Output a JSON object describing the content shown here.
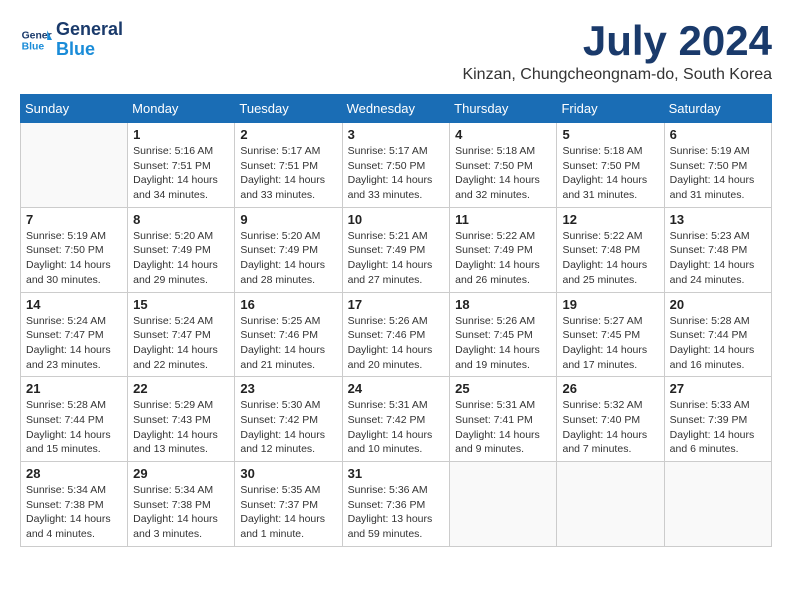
{
  "logo": {
    "line1": "General",
    "line2": "Blue"
  },
  "title": "July 2024",
  "location": "Kinzan, Chungcheongnam-do, South Korea",
  "days_of_week": [
    "Sunday",
    "Monday",
    "Tuesday",
    "Wednesday",
    "Thursday",
    "Friday",
    "Saturday"
  ],
  "weeks": [
    [
      {
        "day": "",
        "info": ""
      },
      {
        "day": "1",
        "info": "Sunrise: 5:16 AM\nSunset: 7:51 PM\nDaylight: 14 hours\nand 34 minutes."
      },
      {
        "day": "2",
        "info": "Sunrise: 5:17 AM\nSunset: 7:51 PM\nDaylight: 14 hours\nand 33 minutes."
      },
      {
        "day": "3",
        "info": "Sunrise: 5:17 AM\nSunset: 7:50 PM\nDaylight: 14 hours\nand 33 minutes."
      },
      {
        "day": "4",
        "info": "Sunrise: 5:18 AM\nSunset: 7:50 PM\nDaylight: 14 hours\nand 32 minutes."
      },
      {
        "day": "5",
        "info": "Sunrise: 5:18 AM\nSunset: 7:50 PM\nDaylight: 14 hours\nand 31 minutes."
      },
      {
        "day": "6",
        "info": "Sunrise: 5:19 AM\nSunset: 7:50 PM\nDaylight: 14 hours\nand 31 minutes."
      }
    ],
    [
      {
        "day": "7",
        "info": "Sunrise: 5:19 AM\nSunset: 7:50 PM\nDaylight: 14 hours\nand 30 minutes."
      },
      {
        "day": "8",
        "info": "Sunrise: 5:20 AM\nSunset: 7:49 PM\nDaylight: 14 hours\nand 29 minutes."
      },
      {
        "day": "9",
        "info": "Sunrise: 5:20 AM\nSunset: 7:49 PM\nDaylight: 14 hours\nand 28 minutes."
      },
      {
        "day": "10",
        "info": "Sunrise: 5:21 AM\nSunset: 7:49 PM\nDaylight: 14 hours\nand 27 minutes."
      },
      {
        "day": "11",
        "info": "Sunrise: 5:22 AM\nSunset: 7:49 PM\nDaylight: 14 hours\nand 26 minutes."
      },
      {
        "day": "12",
        "info": "Sunrise: 5:22 AM\nSunset: 7:48 PM\nDaylight: 14 hours\nand 25 minutes."
      },
      {
        "day": "13",
        "info": "Sunrise: 5:23 AM\nSunset: 7:48 PM\nDaylight: 14 hours\nand 24 minutes."
      }
    ],
    [
      {
        "day": "14",
        "info": "Sunrise: 5:24 AM\nSunset: 7:47 PM\nDaylight: 14 hours\nand 23 minutes."
      },
      {
        "day": "15",
        "info": "Sunrise: 5:24 AM\nSunset: 7:47 PM\nDaylight: 14 hours\nand 22 minutes."
      },
      {
        "day": "16",
        "info": "Sunrise: 5:25 AM\nSunset: 7:46 PM\nDaylight: 14 hours\nand 21 minutes."
      },
      {
        "day": "17",
        "info": "Sunrise: 5:26 AM\nSunset: 7:46 PM\nDaylight: 14 hours\nand 20 minutes."
      },
      {
        "day": "18",
        "info": "Sunrise: 5:26 AM\nSunset: 7:45 PM\nDaylight: 14 hours\nand 19 minutes."
      },
      {
        "day": "19",
        "info": "Sunrise: 5:27 AM\nSunset: 7:45 PM\nDaylight: 14 hours\nand 17 minutes."
      },
      {
        "day": "20",
        "info": "Sunrise: 5:28 AM\nSunset: 7:44 PM\nDaylight: 14 hours\nand 16 minutes."
      }
    ],
    [
      {
        "day": "21",
        "info": "Sunrise: 5:28 AM\nSunset: 7:44 PM\nDaylight: 14 hours\nand 15 minutes."
      },
      {
        "day": "22",
        "info": "Sunrise: 5:29 AM\nSunset: 7:43 PM\nDaylight: 14 hours\nand 13 minutes."
      },
      {
        "day": "23",
        "info": "Sunrise: 5:30 AM\nSunset: 7:42 PM\nDaylight: 14 hours\nand 12 minutes."
      },
      {
        "day": "24",
        "info": "Sunrise: 5:31 AM\nSunset: 7:42 PM\nDaylight: 14 hours\nand 10 minutes."
      },
      {
        "day": "25",
        "info": "Sunrise: 5:31 AM\nSunset: 7:41 PM\nDaylight: 14 hours\nand 9 minutes."
      },
      {
        "day": "26",
        "info": "Sunrise: 5:32 AM\nSunset: 7:40 PM\nDaylight: 14 hours\nand 7 minutes."
      },
      {
        "day": "27",
        "info": "Sunrise: 5:33 AM\nSunset: 7:39 PM\nDaylight: 14 hours\nand 6 minutes."
      }
    ],
    [
      {
        "day": "28",
        "info": "Sunrise: 5:34 AM\nSunset: 7:38 PM\nDaylight: 14 hours\nand 4 minutes."
      },
      {
        "day": "29",
        "info": "Sunrise: 5:34 AM\nSunset: 7:38 PM\nDaylight: 14 hours\nand 3 minutes."
      },
      {
        "day": "30",
        "info": "Sunrise: 5:35 AM\nSunset: 7:37 PM\nDaylight: 14 hours\nand 1 minute."
      },
      {
        "day": "31",
        "info": "Sunrise: 5:36 AM\nSunset: 7:36 PM\nDaylight: 13 hours\nand 59 minutes."
      },
      {
        "day": "",
        "info": ""
      },
      {
        "day": "",
        "info": ""
      },
      {
        "day": "",
        "info": ""
      }
    ]
  ]
}
